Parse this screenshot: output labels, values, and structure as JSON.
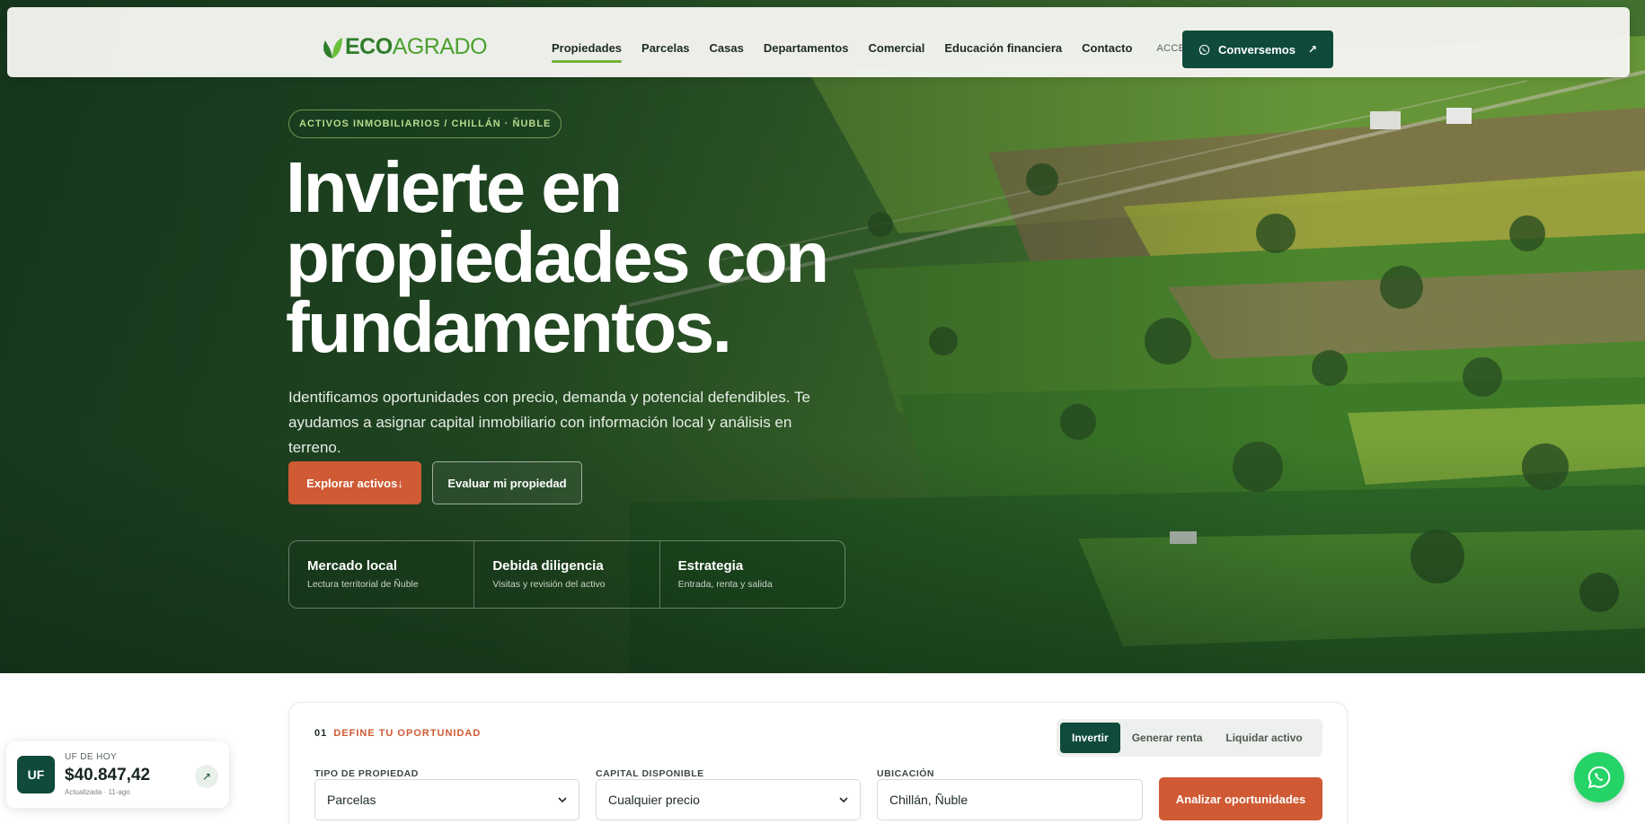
{
  "brand": {
    "name_part1": "ECO",
    "name_part2": "AGRADO"
  },
  "nav": {
    "links": [
      "Propiedades",
      "Parcelas",
      "Casas",
      "Departamentos",
      "Comercial",
      "Educación financiera",
      "Contacto"
    ],
    "active": "Propiedades",
    "acceso": "ACCESO",
    "cta": "Conversemos",
    "cta_arrow": "↗"
  },
  "hero": {
    "eyebrow": "ACTIVOS INMOBILIARIOS / CHILLÁN · ÑUBLE",
    "headline_lines": [
      "Invierte en",
      "propiedades con",
      "fundamentos."
    ],
    "lead": "Identificamos oportunidades con precio, demanda y potencial defendibles. Te ayudamos a asignar capital inmobiliario con información local y análisis en terreno.",
    "primary_cta": "Explorar activos↓",
    "secondary_cta": "Evaluar mi propiedad",
    "features": [
      {
        "title": "Mercado local",
        "subtitle": "Lectura territorial de Ñuble"
      },
      {
        "title": "Debida diligencia",
        "subtitle": "Visitas y revisión del activo"
      },
      {
        "title": "Estrategia",
        "subtitle": "Entrada, renta y salida"
      }
    ]
  },
  "search": {
    "step_number": "01",
    "step_label": "DEFINE TU OPORTUNIDAD",
    "modes": [
      "Invertir",
      "Generar renta",
      "Liquidar activo"
    ],
    "active_mode": "Invertir",
    "fields": {
      "tipo_label": "TIPO DE PROPIEDAD",
      "tipo_value": "Parcelas",
      "capital_label": "CAPITAL DISPONIBLE",
      "capital_value": "Cualquier precio",
      "ubicacion_label": "UBICACIÓN",
      "ubicacion_value": "Chillán, Ñuble"
    },
    "submit": "Analizar oportunidades"
  },
  "uf_widget": {
    "badge": "UF",
    "label": "UF DE HOY",
    "value": "$40.847,42",
    "updated": "Actualizada · 11-ago",
    "arrow": "↗"
  },
  "colors": {
    "accent_green": "#0f4a3b",
    "accent_orange": "#cf5a34",
    "logo_green": "#4ba02e",
    "whatsapp": "#26d367"
  }
}
